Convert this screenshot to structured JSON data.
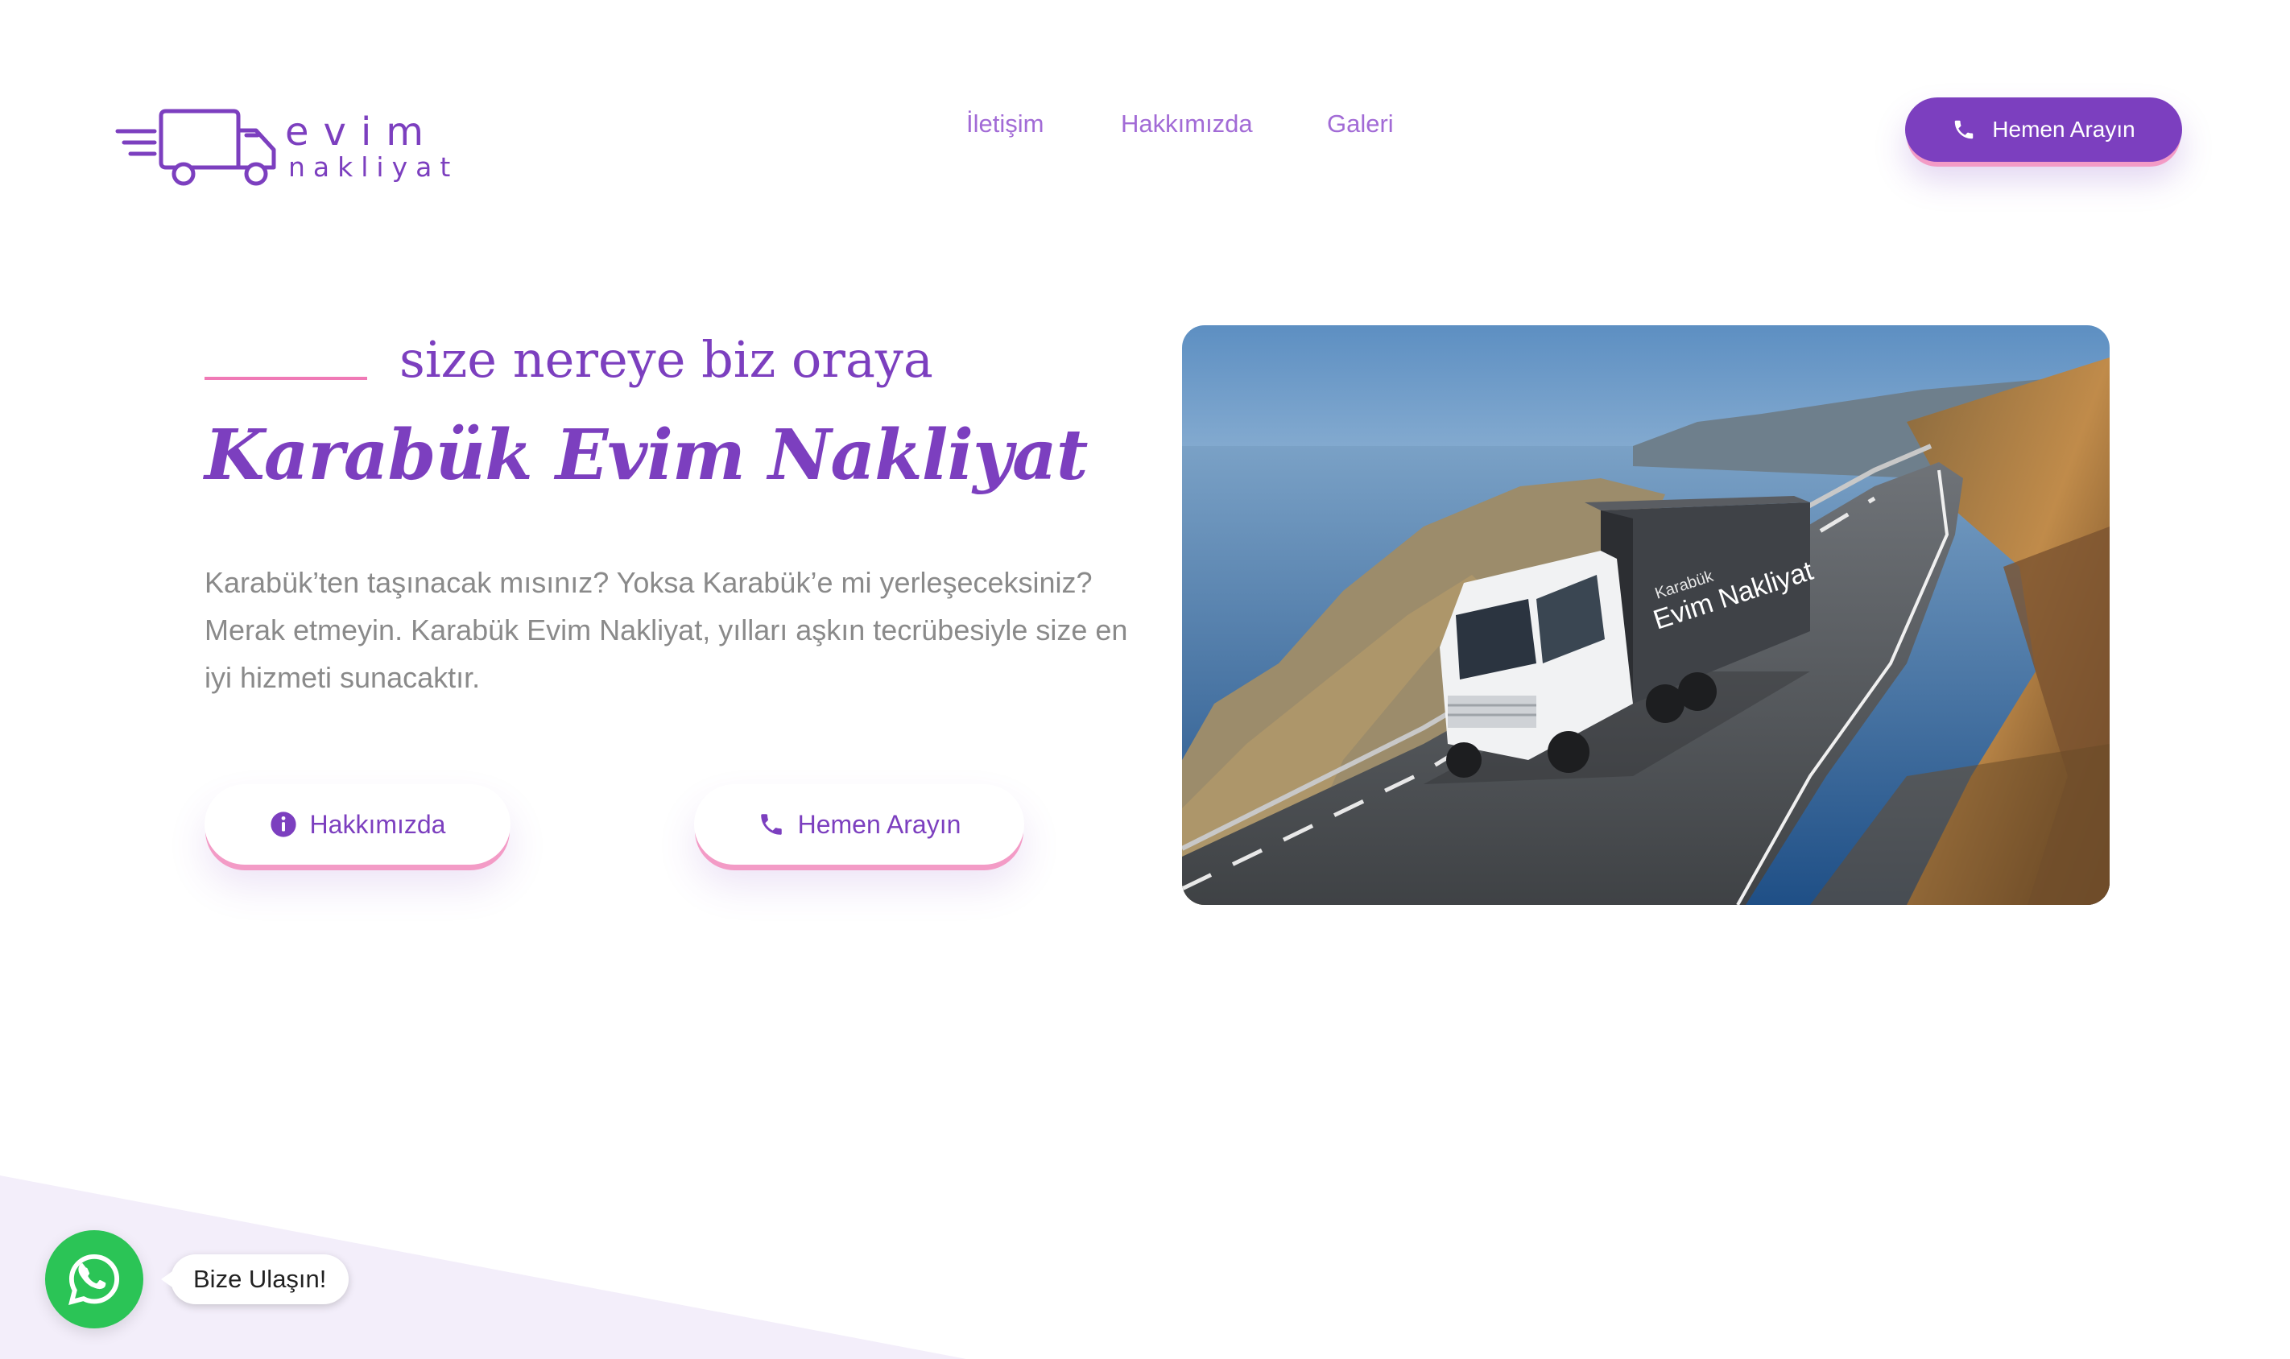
{
  "brand": {
    "word_top": "evim",
    "word_bottom": "nakliyat"
  },
  "nav": {
    "items": [
      {
        "label": "İletişim"
      },
      {
        "label": "Hakkımızda"
      },
      {
        "label": "Galeri"
      }
    ]
  },
  "header": {
    "call_label": "Hemen Arayın"
  },
  "hero": {
    "tagline": "size nereye biz oraya",
    "title": "Karabük Evim Nakliyat",
    "description": "Karabük’ten taşınacak mısınız? Yoksa Karabük’e mi yerleşeceksiniz? Merak etmeyin. Karabük Evim Nakliyat, yılları aşkın tecrübesiyle size en iyi hizmeti sunacaktır.",
    "about_label": "Hakkımızda",
    "call_label": "Hemen Arayın",
    "truck_text_small": "Karabük",
    "truck_text_large": "Evim Nakliyat"
  },
  "whatsapp": {
    "label": "Bize Ulaşın!"
  },
  "colors": {
    "accent": "#7c3fbf",
    "accent_light": "#a26bd6",
    "pink": "#f07ab6",
    "whatsapp": "#2bc456",
    "text_muted": "#8a8a8a"
  },
  "icons": {
    "phone": "phone-icon",
    "info": "info-icon",
    "whatsapp": "whatsapp-icon",
    "logo": "truck-logo-icon"
  }
}
